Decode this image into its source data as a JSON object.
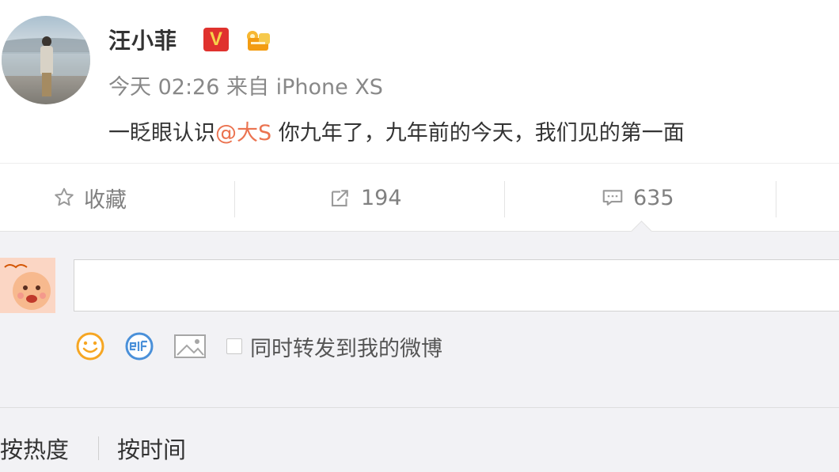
{
  "post": {
    "author": "汪小菲",
    "verified_badge": "V",
    "time": "今天 02:26",
    "source_prefix": "来自",
    "source": "iPhone XS",
    "text_before": "一眨眼认识",
    "mention": "@大S",
    "text_after": " 你九年了，九年前的今天，我们见的第一面"
  },
  "actions": {
    "favorite_label": "收藏",
    "forward_count": "194",
    "comment_count": "635"
  },
  "comment_box": {
    "value": "",
    "share_label": "同时转发到我的微博"
  },
  "sort": {
    "hot_label": "按热度",
    "time_label": "按时间"
  },
  "icons": [
    "star-icon",
    "forward-icon",
    "comment-icon",
    "emoji-icon",
    "gif-icon",
    "image-icon"
  ],
  "colors": {
    "mention": "#eb7350",
    "vbadge_bg": "#e0322e",
    "vbadge_fg": "#f7d24a",
    "meta_text": "#888888",
    "comment_bg": "#f2f2f5",
    "emoji_orange": "#f6a623",
    "gif_blue": "#4a90d9"
  }
}
